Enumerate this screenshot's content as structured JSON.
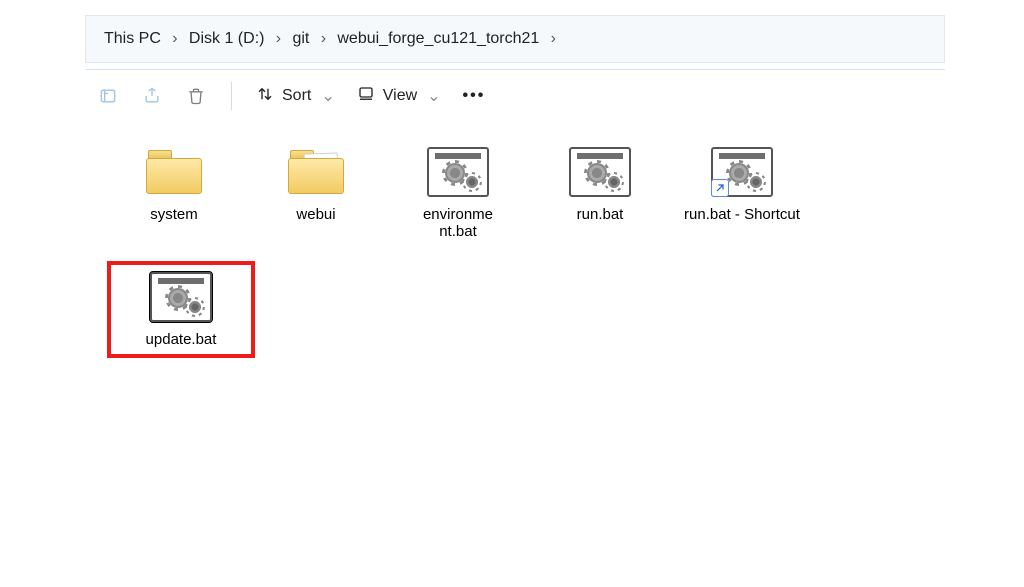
{
  "breadcrumb": {
    "items": [
      {
        "label": "This PC"
      },
      {
        "label": "Disk 1 (D:)"
      },
      {
        "label": "git"
      },
      {
        "label": "webui_forge_cu121_torch21"
      }
    ]
  },
  "toolbar": {
    "rename_icon": "rename-icon",
    "share_icon": "share-icon",
    "delete_icon": "trash-icon",
    "sort_label": "Sort",
    "view_label": "View",
    "more_label": "•••"
  },
  "files": [
    {
      "label": "system",
      "icon": "folder",
      "selected": false,
      "highlighted": false,
      "shortcut": false
    },
    {
      "label": "webui",
      "icon": "folder-open",
      "selected": false,
      "highlighted": false,
      "shortcut": false
    },
    {
      "label": "environme\nnt.bat",
      "icon": "bat",
      "selected": false,
      "highlighted": false,
      "shortcut": false
    },
    {
      "label": "run.bat",
      "icon": "bat",
      "selected": false,
      "highlighted": false,
      "shortcut": false
    },
    {
      "label": "run.bat - Shortcut",
      "icon": "bat",
      "selected": false,
      "highlighted": false,
      "shortcut": true
    },
    {
      "label": "update.bat",
      "icon": "bat",
      "selected": true,
      "highlighted": true,
      "shortcut": false
    }
  ]
}
